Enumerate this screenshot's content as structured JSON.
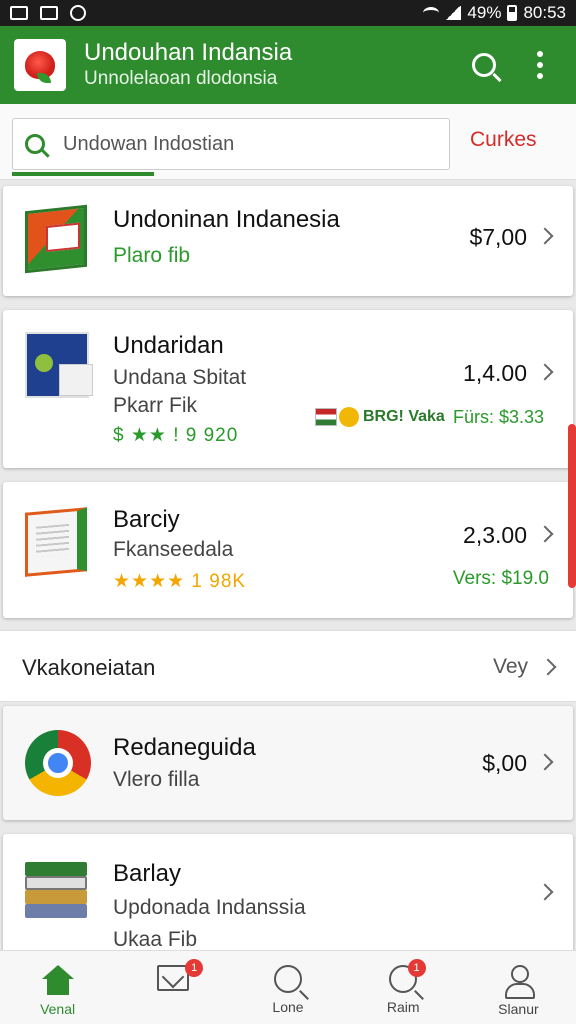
{
  "status": {
    "battery": "49%",
    "time": "80:53"
  },
  "appbar": {
    "title": "Undouhan Indansia",
    "subtitle": "Unnolelaoan dlodonsia"
  },
  "search": {
    "value": "Undowan Indostian",
    "action_label": "Curkes"
  },
  "items": [
    {
      "title": "Undoninan Indanesia",
      "sub": "Plaro fib",
      "price": "$7,00"
    },
    {
      "title": "Undaridan",
      "sub": "Undana Sbitat",
      "sub2": "Pkarr Fik",
      "rating": "$ ★★ ! 9 920",
      "price": "1,4.00",
      "promo": "BRG! Vaka",
      "promo2": "Fürs: $3.33"
    },
    {
      "title": "Barciy",
      "sub": "Fkanseedala",
      "rating": "★★★★ 1 98K",
      "price": "2,3.00",
      "price_note": "Vers: $19.0"
    }
  ],
  "section": {
    "label": "Vkakoneiatan",
    "link": "Vey"
  },
  "more_items": [
    {
      "title": "Redaneguida",
      "sub": "Vlero filla",
      "price": "$,00"
    },
    {
      "title": "Barlay",
      "sub": "Updonada Indanssia",
      "sub2": "Ukaa Fib"
    }
  ],
  "nav": [
    {
      "label": "Venal",
      "icon": "home-icon"
    },
    {
      "label": "",
      "icon": "mail-icon",
      "badge": "1"
    },
    {
      "label": "Lone",
      "icon": "search-icon"
    },
    {
      "label": "Raim",
      "icon": "search-icon",
      "badge": "1"
    },
    {
      "label": "Slanur",
      "icon": "user-icon"
    }
  ],
  "colors": {
    "primary": "#2e8b2e",
    "accent": "#d42b2b",
    "badge": "#e53935"
  }
}
